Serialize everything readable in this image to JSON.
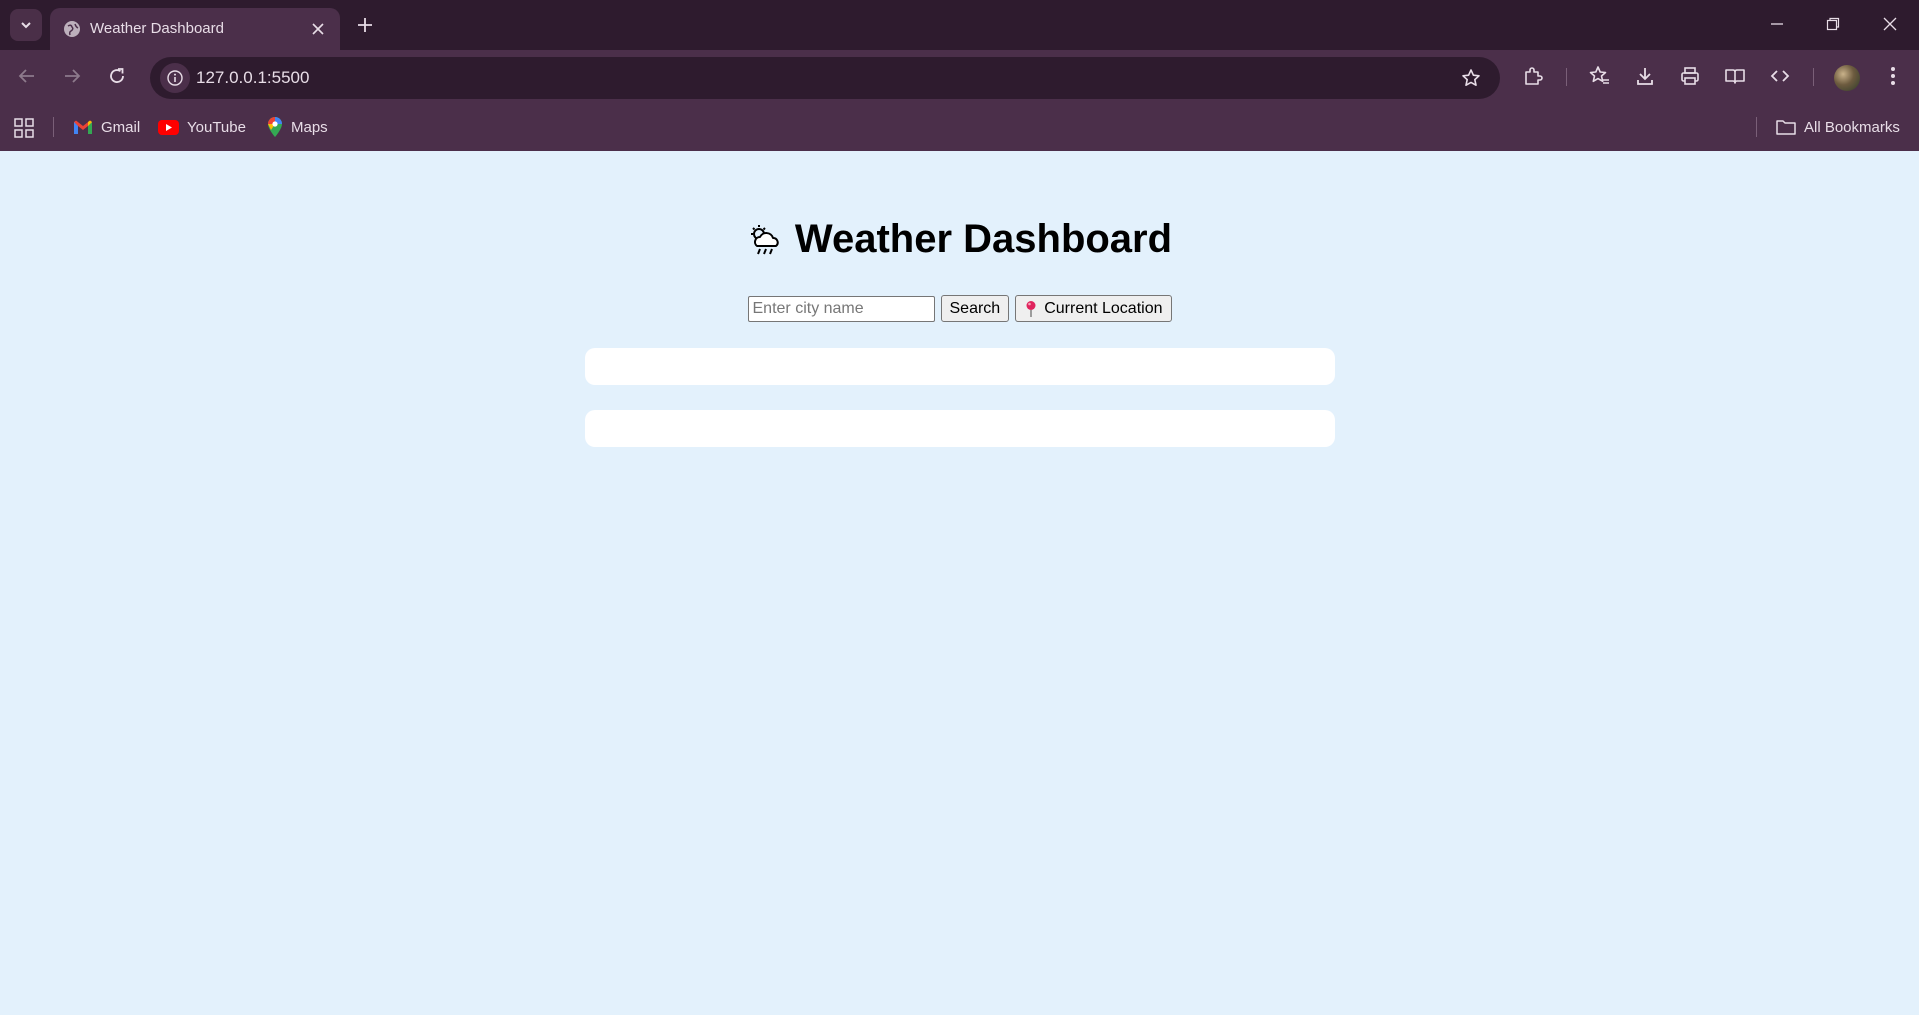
{
  "browser": {
    "tab_title": "Weather Dashboard",
    "url": "127.0.0.1:5500",
    "bookmarks": [
      {
        "label": "Gmail",
        "icon": "gmail-icon"
      },
      {
        "label": "YouTube",
        "icon": "youtube-icon"
      },
      {
        "label": "Maps",
        "icon": "maps-icon"
      }
    ],
    "all_bookmarks_label": "All Bookmarks",
    "theme": {
      "frame": "#2e1b2e",
      "toolbar": "#4b2f4a",
      "text": "#e8dde7"
    }
  },
  "page": {
    "title": "Weather Dashboard",
    "title_icon": "cloud-rain-sun-icon",
    "search": {
      "placeholder": "Enter city name",
      "value": "",
      "search_label": "Search",
      "location_label": "Current Location",
      "location_icon": "location-pin-icon"
    },
    "background": "#e3f1fc",
    "card_color": "#ffffff"
  }
}
